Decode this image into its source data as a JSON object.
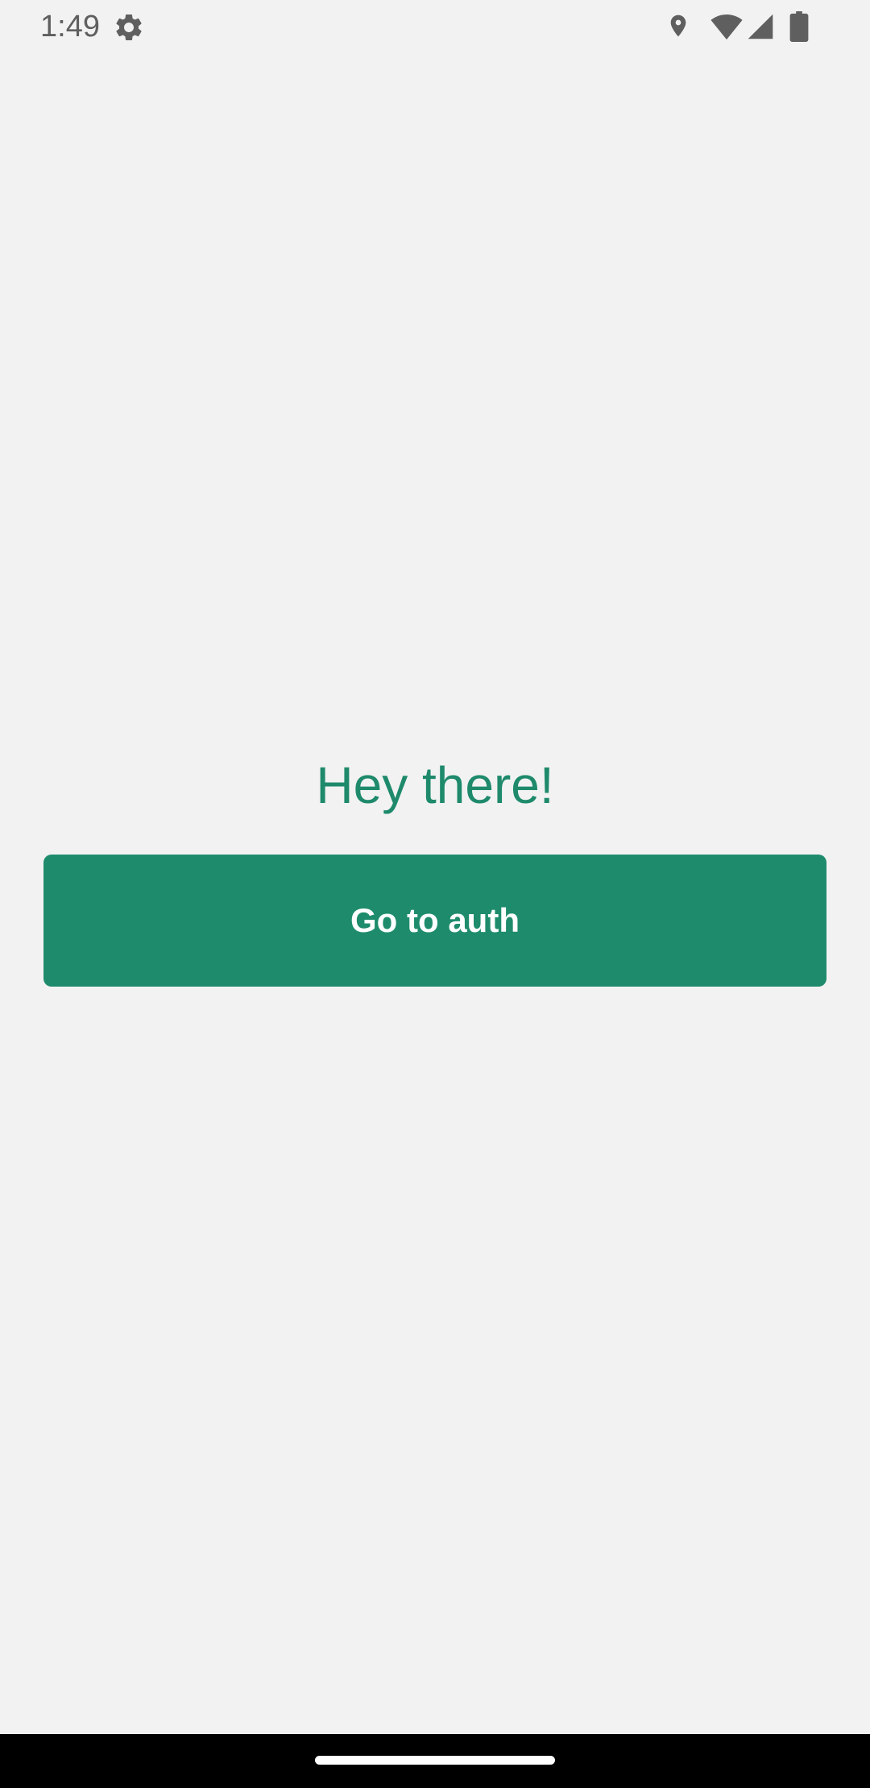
{
  "status_bar": {
    "time": "1:49",
    "icons": [
      "gear-icon",
      "location-icon",
      "wifi-icon",
      "cellular-signal-icon",
      "battery-icon"
    ],
    "icon_color": "#5f5f5f"
  },
  "main": {
    "greeting": "Hey there!",
    "auth_button_label": "Go to auth"
  },
  "colors": {
    "accent": "#1e8c6c",
    "background": "#f2f2f2",
    "nav_bar": "#000000"
  }
}
